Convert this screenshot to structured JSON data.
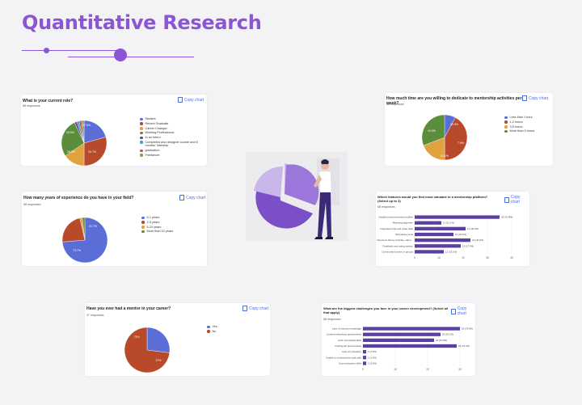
{
  "page": {
    "title": "Quantitative Research"
  },
  "colors": {
    "accent": "#8b55d6",
    "blue": "#5b6ed8",
    "red": "#b84a2b",
    "orange": "#e0a13e",
    "green": "#5b8e3a",
    "purple": "#7a3d97",
    "teal": "#3fa6b4",
    "bar": "#5b3fa2"
  },
  "cards": {
    "role": {
      "question": "What is your current role?",
      "responses": "58 responses",
      "copy_label": "Copy chart",
      "legend": [
        {
          "label": "Student",
          "color": "#5b6ed8"
        },
        {
          "label": "Recent Graduate",
          "color": "#b84a2b"
        },
        {
          "label": "Career Changer",
          "color": "#e0a13e"
        },
        {
          "label": "Working Professional",
          "color": "#5b8e3a"
        },
        {
          "label": "In an Intern",
          "color": "#7a3d97"
        },
        {
          "label": "Completed a/ux designer course and 6 months' Intership",
          "color": "#3fa6b4"
        },
        {
          "label": "graduation",
          "color": "#c44a6a"
        },
        {
          "label": "Freelancer",
          "color": "#8aa33a"
        }
      ],
      "slice_labels": [
        "20.7%",
        "29.3%",
        "15.5%",
        "27.6%"
      ]
    },
    "time": {
      "question": "How much time are you willing to dedicate to mentorship activities per week?",
      "responses": "58 responses",
      "copy_label": "Copy chart",
      "legend": [
        {
          "label": "Less than 1 hour",
          "color": "#5b6ed8"
        },
        {
          "label": "1-2 hours",
          "color": "#b84a2b"
        },
        {
          "label": "3-5 hours",
          "color": "#e0a13e"
        },
        {
          "label": "More than 5 hours",
          "color": "#5b8e3a"
        }
      ],
      "slice_labels": [
        "7.9%",
        "42.1%",
        "19.3%",
        "30.9%"
      ]
    },
    "experience": {
      "question": "How many years of experience do you have in your field?",
      "responses": "58 responses",
      "copy_label": "Copy chart",
      "legend": [
        {
          "label": "0-1 years",
          "color": "#5b6ed8"
        },
        {
          "label": "2-5 years",
          "color": "#b84a2b"
        },
        {
          "label": "6-10 years",
          "color": "#e0a13e"
        },
        {
          "label": "More than 10 years",
          "color": "#5b8e3a"
        }
      ],
      "slice_labels": [
        "73.7%",
        "22.7%"
      ]
    },
    "features": {
      "question": "Which features would you find most valuable in a mentorship platform? (Select up to 3)",
      "responses": "58 responses",
      "copy_label": "Copy chart"
    },
    "mentor": {
      "question": "Have you ever had a mentor in your career?",
      "responses": "37 responses",
      "copy_label": "Copy chart",
      "legend": [
        {
          "label": "Yes",
          "color": "#5b6ed8"
        },
        {
          "label": "No",
          "color": "#b84a2b"
        }
      ],
      "slice_labels": [
        "73%",
        "27%"
      ]
    },
    "challenges": {
      "question": "What are the biggest challenges you face in your career development? (Select all that apply)",
      "responses": "58 responses",
      "copy_label": "Copy chart"
    }
  },
  "chart_data": [
    {
      "type": "pie",
      "title": "What is your current role?",
      "categories": [
        "Student",
        "Recent Graduate",
        "Career Changer",
        "Working Professional",
        "In an Intern",
        "Completed a/ux designer course and 6 months' Intership",
        "graduation",
        "Freelancer"
      ],
      "values": [
        20.7,
        29.3,
        15.5,
        27.6,
        1.7,
        1.7,
        1.7,
        1.8
      ]
    },
    {
      "type": "pie",
      "title": "How much time are you willing to dedicate to mentorship activities per week?",
      "categories": [
        "Less than 1 hour",
        "1-2 hours",
        "3-5 hours",
        "More than 5 hours"
      ],
      "values": [
        7.9,
        42.1,
        19.3,
        30.9
      ]
    },
    {
      "type": "pie",
      "title": "How many years of experience do you have in your field?",
      "categories": [
        "0-1 years",
        "2-5 years",
        "6-10 years",
        "More than 10 years"
      ],
      "values": [
        73.7,
        22.7,
        1.8,
        1.8
      ]
    },
    {
      "type": "pie",
      "title": "Have you ever had a mentor in your career?",
      "categories": [
        "Yes",
        "No"
      ],
      "values": [
        27,
        73
      ]
    },
    {
      "type": "bar",
      "orientation": "horizontal",
      "title": "Which features would you find most valuable in a mentorship platform? (Select up to 3)",
      "categories": [
        "Detailed mentor/mentee profiles",
        "Matching algorithm",
        "Integrated chat and video calls",
        "Scheduling tools",
        "Resource library (articles, video...",
        "Feedback and rating system",
        "Community forums or groups"
      ],
      "values": [
        35,
        11,
        21,
        16,
        23,
        19,
        12
      ],
      "data_labels": [
        "35 (70.8%)",
        "11 (21.1%)",
        "21 (40.4%)",
        "16 (30.1%)",
        "23 (44.2%)",
        "19 (37.5%)",
        "12 (23.1%)"
      ],
      "xlim": [
        0,
        40
      ],
      "xticks": [
        "0",
        "10",
        "20",
        "30",
        "40"
      ]
    },
    {
      "type": "bar",
      "orientation": "horizontal",
      "title": "What are the biggest challenges you face in your career development? (Select all that apply)",
      "categories": [
        "Lack of industry knowledge",
        "Limited networking opportunities",
        "Lack of practical skills",
        "Finding job opportunities",
        "Lack of motivation",
        "Unable to choosing the right path",
        "Communication skills"
      ],
      "values": [
        30,
        24,
        22,
        29,
        1,
        1,
        1
      ],
      "data_labels": [
        "30 (78.9%)",
        "24 (63.2%)",
        "22 (57.9%)",
        "29 (76.3%)",
        "1 (2.6%)",
        "1 (2.6%)",
        "1 (2.6%)"
      ],
      "xlim": [
        0,
        30
      ],
      "xticks": [
        "0",
        "10",
        "20",
        "30"
      ]
    }
  ]
}
